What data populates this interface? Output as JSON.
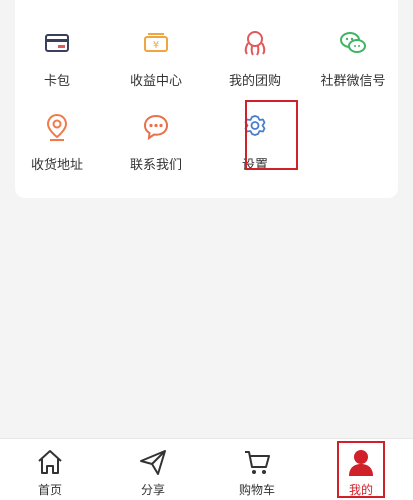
{
  "menu": {
    "items": [
      {
        "label": "卡包",
        "icon": "card-wallet-icon"
      },
      {
        "label": "收益中心",
        "icon": "yuan-earnings-icon"
      },
      {
        "label": "我的团购",
        "icon": "group-buy-icon"
      },
      {
        "label": "社群微信号",
        "icon": "wechat-icon"
      },
      {
        "label": "收货地址",
        "icon": "location-pin-icon"
      },
      {
        "label": "联系我们",
        "icon": "chat-bubble-icon"
      },
      {
        "label": "设置",
        "icon": "gear-icon"
      }
    ]
  },
  "tabbar": {
    "tabs": [
      {
        "label": "首页",
        "icon": "home-icon"
      },
      {
        "label": "分享",
        "icon": "paper-plane-icon"
      },
      {
        "label": "购物车",
        "icon": "cart-icon"
      },
      {
        "label": "我的",
        "icon": "user-icon",
        "active": true
      }
    ]
  },
  "colors": {
    "accent": "#d0212a",
    "card_icon": "#3a3f5c",
    "earnings_icon": "#f0a640",
    "group_icon": "#e05a5a",
    "wechat_icon": "#3db562",
    "location_icon": "#f07a4a",
    "contact_icon": "#e8704a",
    "settings_icon": "#4a7fcf"
  }
}
